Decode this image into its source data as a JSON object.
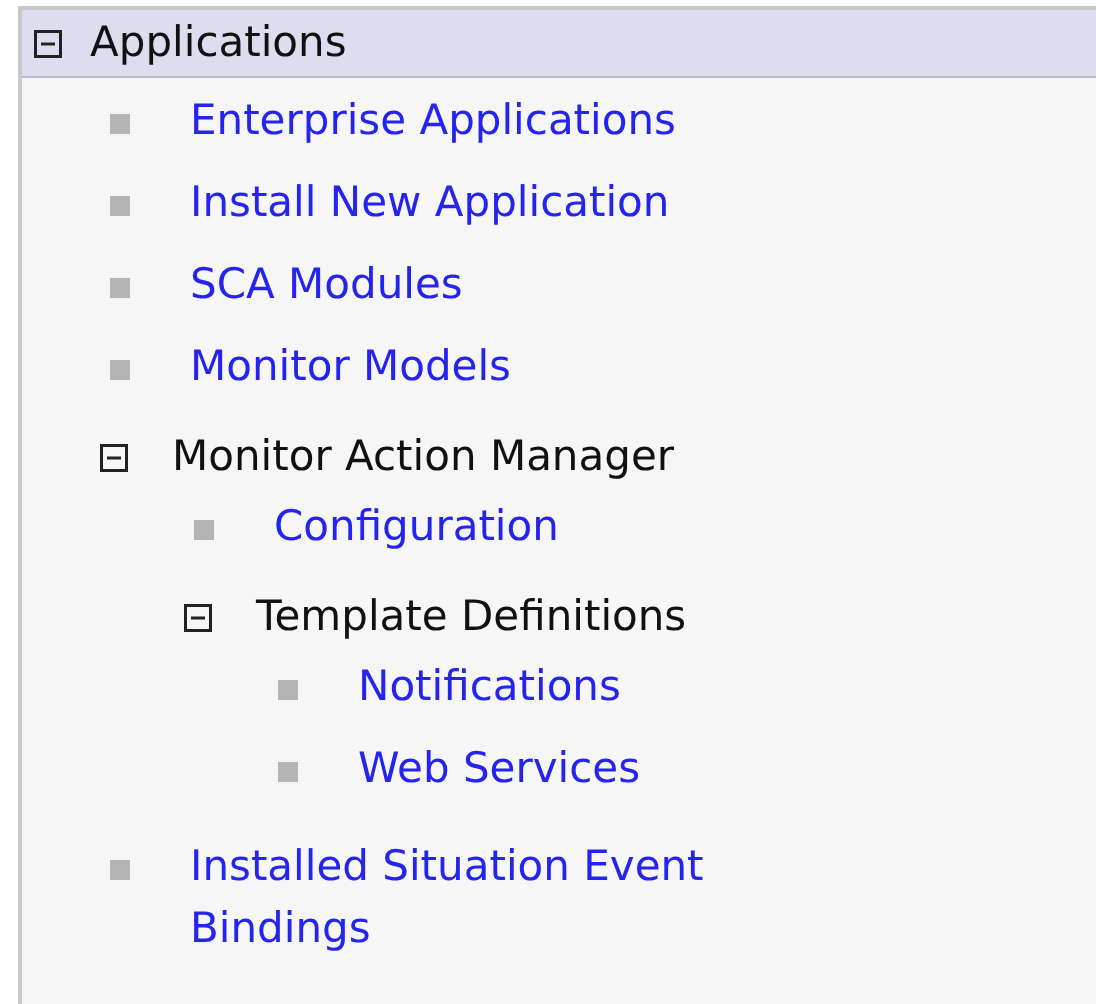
{
  "tree": {
    "label": "Applications",
    "expanded": true,
    "children": [
      {
        "kind": "link",
        "label": "Enterprise Applications"
      },
      {
        "kind": "link",
        "label": "Install New Application"
      },
      {
        "kind": "link",
        "label": "SCA Modules"
      },
      {
        "kind": "link",
        "label": "Monitor Models"
      },
      {
        "kind": "folder",
        "label": "Monitor Action Manager",
        "expanded": true,
        "children": [
          {
            "kind": "link",
            "label": "Configuration"
          },
          {
            "kind": "folder",
            "label": "Template Definitions",
            "expanded": true,
            "children": [
              {
                "kind": "link",
                "label": "Notifications"
              },
              {
                "kind": "link",
                "label": "Web Services"
              }
            ]
          }
        ]
      },
      {
        "kind": "link",
        "label": "Installed Situation Event Bindings"
      }
    ]
  }
}
